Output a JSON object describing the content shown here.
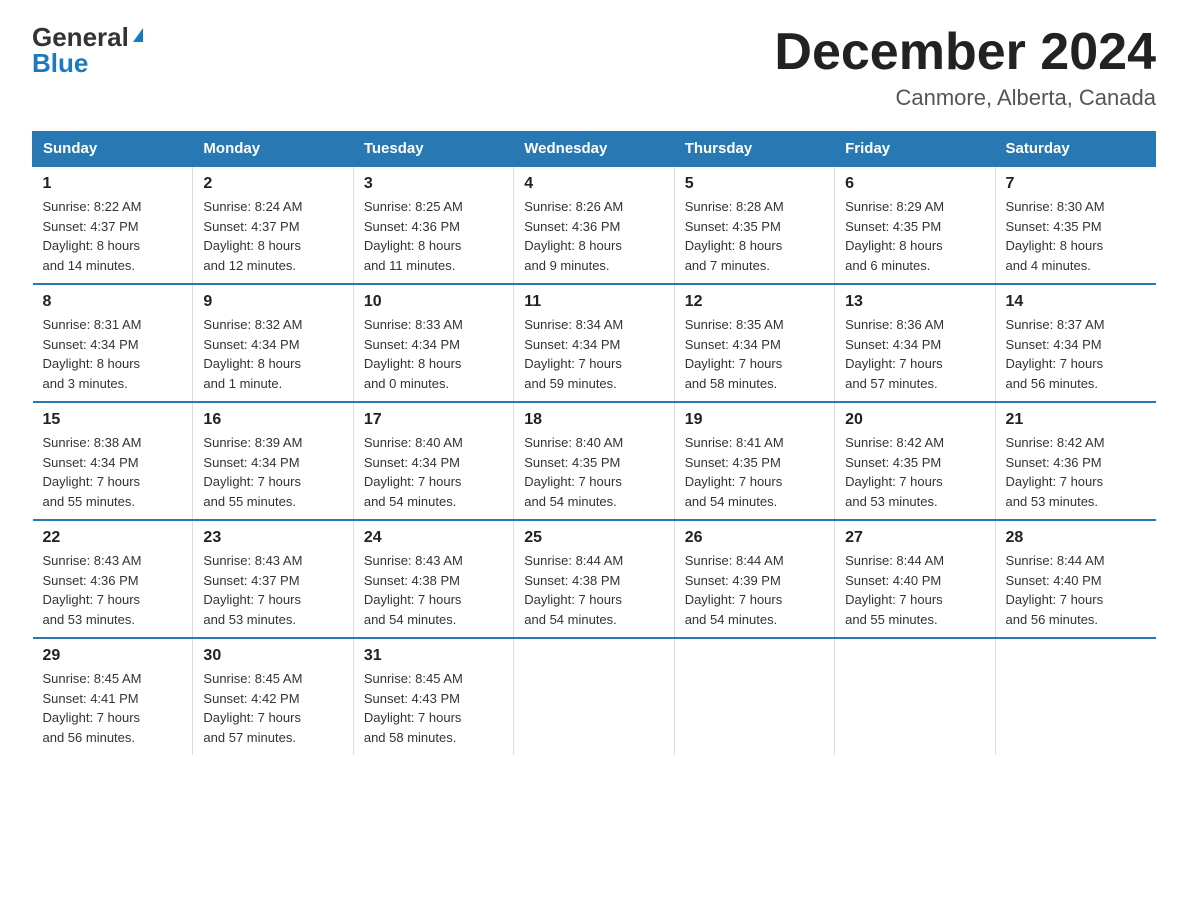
{
  "header": {
    "logo_general": "General",
    "logo_blue": "Blue",
    "main_title": "December 2024",
    "subtitle": "Canmore, Alberta, Canada"
  },
  "columns": [
    "Sunday",
    "Monday",
    "Tuesday",
    "Wednesday",
    "Thursday",
    "Friday",
    "Saturday"
  ],
  "weeks": [
    [
      {
        "day": "1",
        "info": "Sunrise: 8:22 AM\nSunset: 4:37 PM\nDaylight: 8 hours\nand 14 minutes."
      },
      {
        "day": "2",
        "info": "Sunrise: 8:24 AM\nSunset: 4:37 PM\nDaylight: 8 hours\nand 12 minutes."
      },
      {
        "day": "3",
        "info": "Sunrise: 8:25 AM\nSunset: 4:36 PM\nDaylight: 8 hours\nand 11 minutes."
      },
      {
        "day": "4",
        "info": "Sunrise: 8:26 AM\nSunset: 4:36 PM\nDaylight: 8 hours\nand 9 minutes."
      },
      {
        "day": "5",
        "info": "Sunrise: 8:28 AM\nSunset: 4:35 PM\nDaylight: 8 hours\nand 7 minutes."
      },
      {
        "day": "6",
        "info": "Sunrise: 8:29 AM\nSunset: 4:35 PM\nDaylight: 8 hours\nand 6 minutes."
      },
      {
        "day": "7",
        "info": "Sunrise: 8:30 AM\nSunset: 4:35 PM\nDaylight: 8 hours\nand 4 minutes."
      }
    ],
    [
      {
        "day": "8",
        "info": "Sunrise: 8:31 AM\nSunset: 4:34 PM\nDaylight: 8 hours\nand 3 minutes."
      },
      {
        "day": "9",
        "info": "Sunrise: 8:32 AM\nSunset: 4:34 PM\nDaylight: 8 hours\nand 1 minute."
      },
      {
        "day": "10",
        "info": "Sunrise: 8:33 AM\nSunset: 4:34 PM\nDaylight: 8 hours\nand 0 minutes."
      },
      {
        "day": "11",
        "info": "Sunrise: 8:34 AM\nSunset: 4:34 PM\nDaylight: 7 hours\nand 59 minutes."
      },
      {
        "day": "12",
        "info": "Sunrise: 8:35 AM\nSunset: 4:34 PM\nDaylight: 7 hours\nand 58 minutes."
      },
      {
        "day": "13",
        "info": "Sunrise: 8:36 AM\nSunset: 4:34 PM\nDaylight: 7 hours\nand 57 minutes."
      },
      {
        "day": "14",
        "info": "Sunrise: 8:37 AM\nSunset: 4:34 PM\nDaylight: 7 hours\nand 56 minutes."
      }
    ],
    [
      {
        "day": "15",
        "info": "Sunrise: 8:38 AM\nSunset: 4:34 PM\nDaylight: 7 hours\nand 55 minutes."
      },
      {
        "day": "16",
        "info": "Sunrise: 8:39 AM\nSunset: 4:34 PM\nDaylight: 7 hours\nand 55 minutes."
      },
      {
        "day": "17",
        "info": "Sunrise: 8:40 AM\nSunset: 4:34 PM\nDaylight: 7 hours\nand 54 minutes."
      },
      {
        "day": "18",
        "info": "Sunrise: 8:40 AM\nSunset: 4:35 PM\nDaylight: 7 hours\nand 54 minutes."
      },
      {
        "day": "19",
        "info": "Sunrise: 8:41 AM\nSunset: 4:35 PM\nDaylight: 7 hours\nand 54 minutes."
      },
      {
        "day": "20",
        "info": "Sunrise: 8:42 AM\nSunset: 4:35 PM\nDaylight: 7 hours\nand 53 minutes."
      },
      {
        "day": "21",
        "info": "Sunrise: 8:42 AM\nSunset: 4:36 PM\nDaylight: 7 hours\nand 53 minutes."
      }
    ],
    [
      {
        "day": "22",
        "info": "Sunrise: 8:43 AM\nSunset: 4:36 PM\nDaylight: 7 hours\nand 53 minutes."
      },
      {
        "day": "23",
        "info": "Sunrise: 8:43 AM\nSunset: 4:37 PM\nDaylight: 7 hours\nand 53 minutes."
      },
      {
        "day": "24",
        "info": "Sunrise: 8:43 AM\nSunset: 4:38 PM\nDaylight: 7 hours\nand 54 minutes."
      },
      {
        "day": "25",
        "info": "Sunrise: 8:44 AM\nSunset: 4:38 PM\nDaylight: 7 hours\nand 54 minutes."
      },
      {
        "day": "26",
        "info": "Sunrise: 8:44 AM\nSunset: 4:39 PM\nDaylight: 7 hours\nand 54 minutes."
      },
      {
        "day": "27",
        "info": "Sunrise: 8:44 AM\nSunset: 4:40 PM\nDaylight: 7 hours\nand 55 minutes."
      },
      {
        "day": "28",
        "info": "Sunrise: 8:44 AM\nSunset: 4:40 PM\nDaylight: 7 hours\nand 56 minutes."
      }
    ],
    [
      {
        "day": "29",
        "info": "Sunrise: 8:45 AM\nSunset: 4:41 PM\nDaylight: 7 hours\nand 56 minutes."
      },
      {
        "day": "30",
        "info": "Sunrise: 8:45 AM\nSunset: 4:42 PM\nDaylight: 7 hours\nand 57 minutes."
      },
      {
        "day": "31",
        "info": "Sunrise: 8:45 AM\nSunset: 4:43 PM\nDaylight: 7 hours\nand 58 minutes."
      },
      {
        "day": "",
        "info": ""
      },
      {
        "day": "",
        "info": ""
      },
      {
        "day": "",
        "info": ""
      },
      {
        "day": "",
        "info": ""
      }
    ]
  ]
}
